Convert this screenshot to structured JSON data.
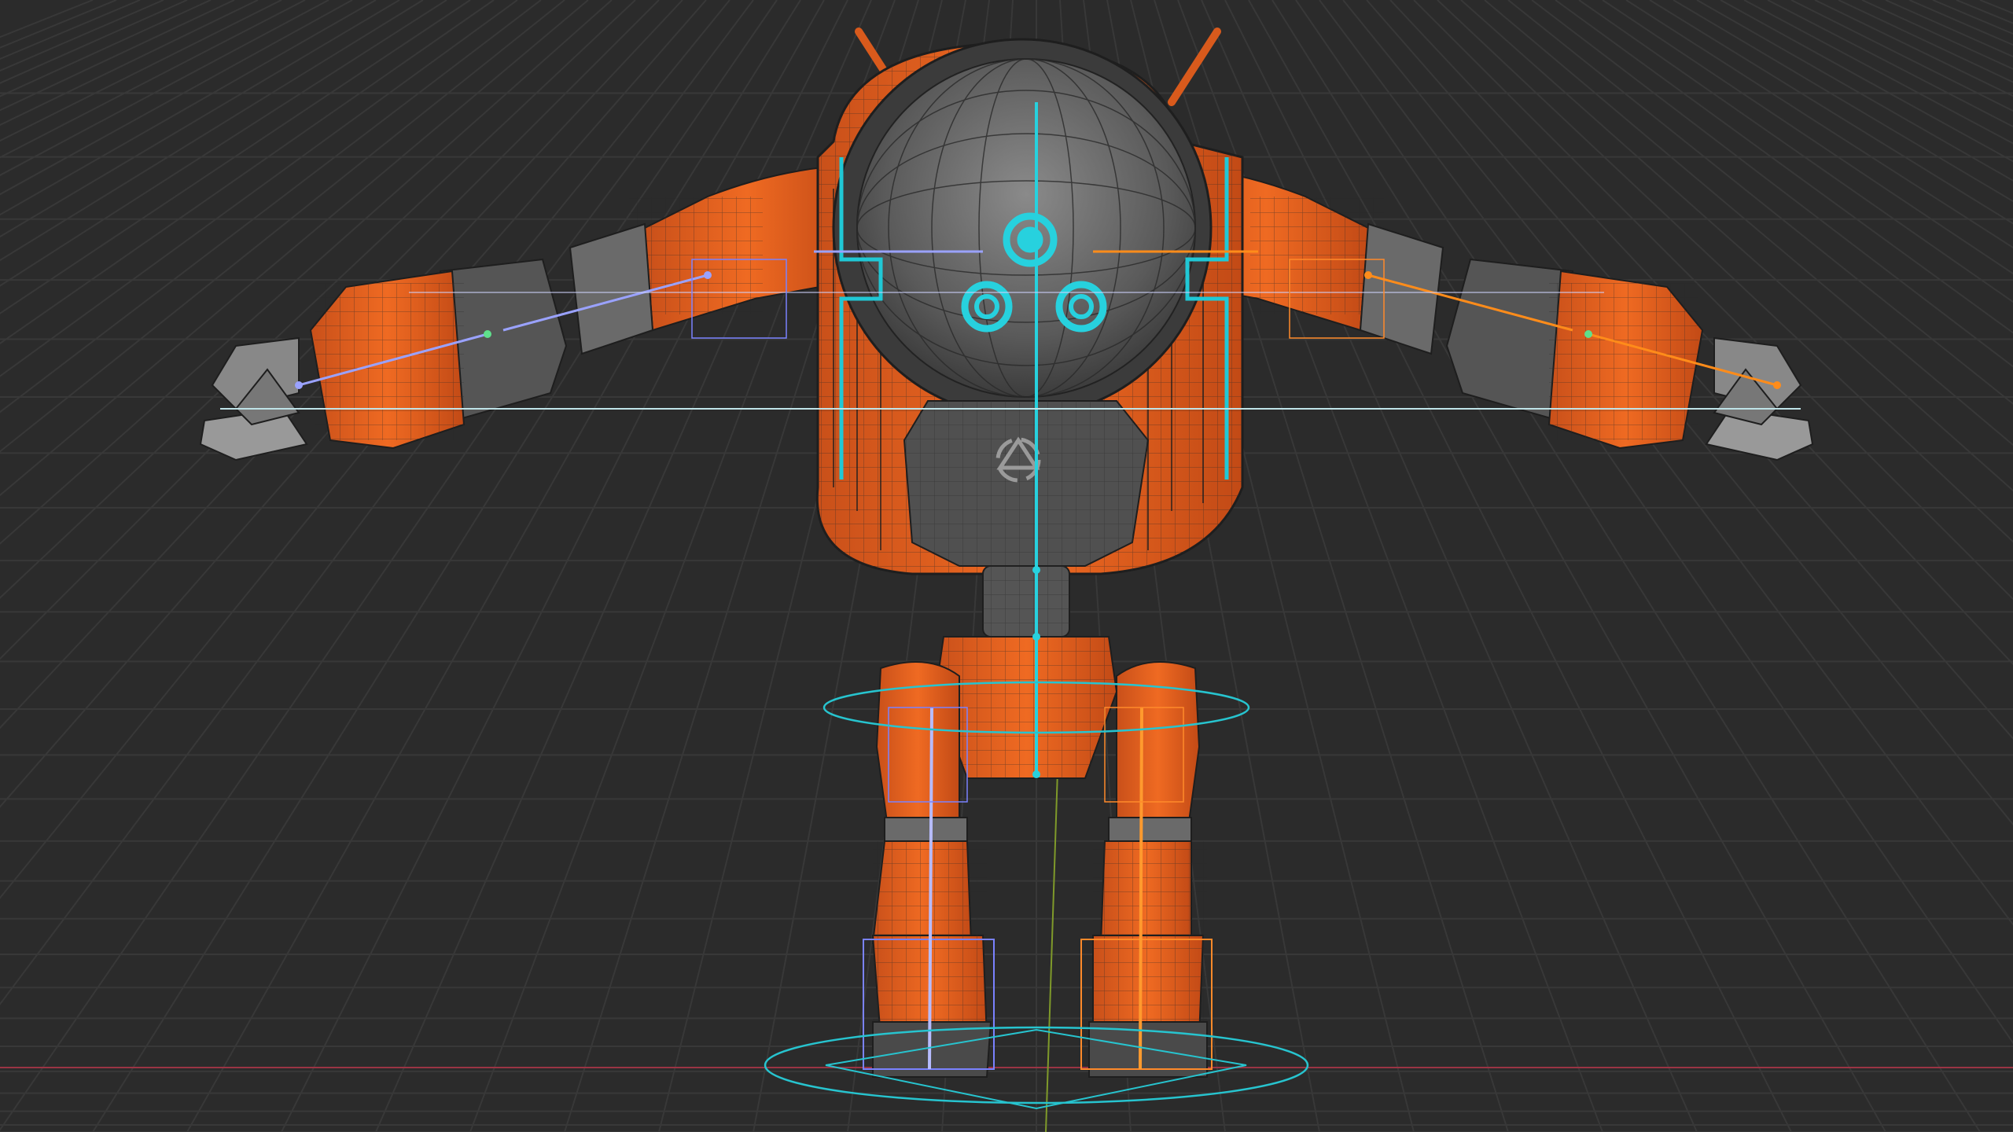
{
  "viewport": {
    "label": "",
    "mode": "3d-viewport-wireframe-overlay",
    "background": "#2b2b2b",
    "grid_color": "#3a3a3a",
    "x_axis_color": "#b23a48",
    "y_axis_color": "#8aa33a"
  },
  "model": {
    "name": "",
    "primary_color": "#e8651f",
    "secondary_color": "#6e6e6e",
    "accent_color": "#2ad4e0",
    "bone_color_left": "#8f9bff",
    "bone_color_right": "#ff8c1a",
    "emblem_icon": "recycle-icon"
  }
}
